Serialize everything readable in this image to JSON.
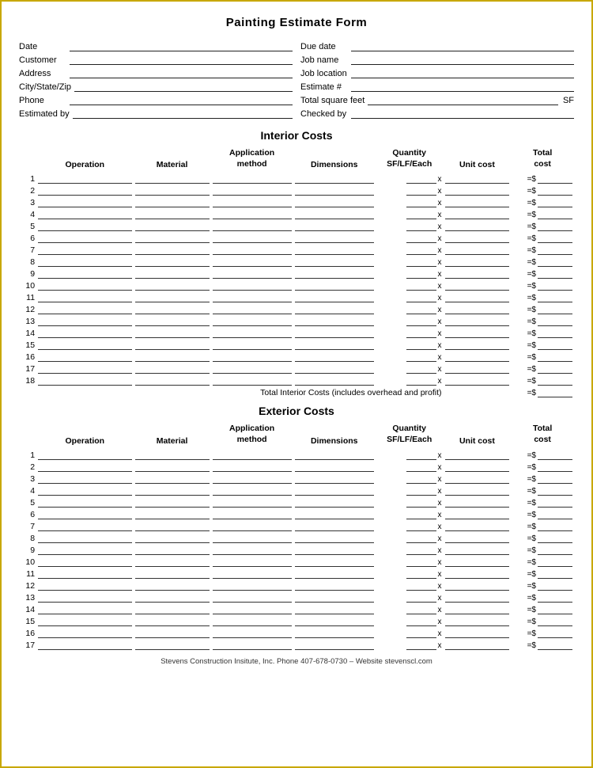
{
  "title": "Painting Estimate Form",
  "header": {
    "left": [
      {
        "label": "Date"
      },
      {
        "label": "Customer"
      },
      {
        "label": "Address"
      },
      {
        "label": "City/State/Zip"
      },
      {
        "label": "Phone"
      },
      {
        "label": "Estimated by"
      }
    ],
    "right": [
      {
        "label": "Due date"
      },
      {
        "label": "Job name"
      },
      {
        "label": "Job location"
      },
      {
        "label": "Estimate #"
      },
      {
        "label": "Total square feet",
        "suffix": "SF"
      },
      {
        "label": "Checked by"
      }
    ]
  },
  "interior": {
    "title": "Interior Costs",
    "columns": [
      "Operation",
      "Material",
      "Application\nmethod",
      "Dimensions",
      "Quantity\nSF/LF/Each",
      "Unit cost",
      "Total\ncost"
    ],
    "rows": 18,
    "total_label": "Total Interior Costs (includes overhead and profit)"
  },
  "exterior": {
    "title": "Exterior Costs",
    "columns": [
      "Operation",
      "Material",
      "Application\nmethod",
      "Dimensions",
      "Quantity\nSF/LF/Each",
      "Unit cost",
      "Total\ncost"
    ],
    "rows": 17,
    "total_label": ""
  },
  "footer": "Stevens Construction Insitute, Inc. Phone 407-678-0730 – Website stevenscl.com"
}
